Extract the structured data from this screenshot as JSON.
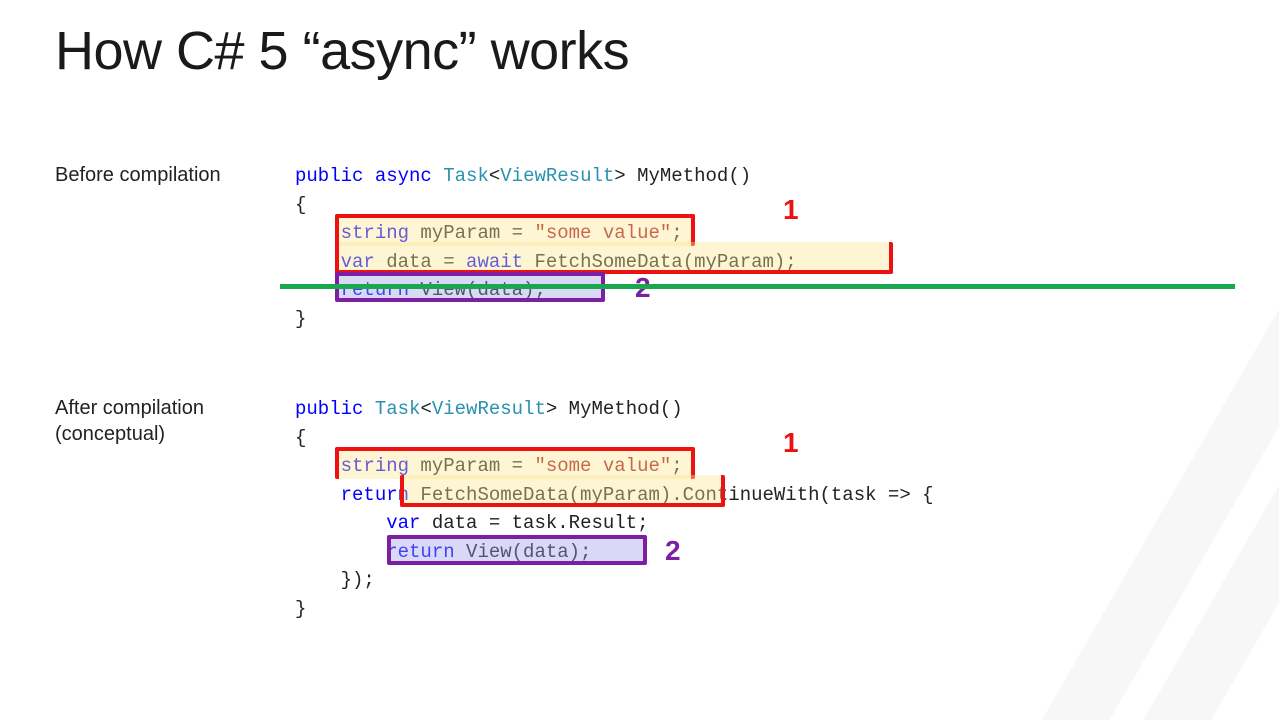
{
  "title": "How C# 5 “async” works",
  "sections": {
    "before": {
      "label": "Before compilation",
      "code": {
        "line1_kw_public": "public",
        "line1_kw_async": "async",
        "line1_type_task": "Task",
        "line1_type_vr": "ViewResult",
        "line1_method": " MyMethod()",
        "line2_brace": "{",
        "line3_kw_string": "string",
        "line3_rest": " myParam = ",
        "line3_str": "\"some value\"",
        "line3_semi": ";",
        "line4_kw_var": "var",
        "line4_data": " data = ",
        "line4_kw_await": "await",
        "line4_call": " FetchSomeData(myParam);",
        "line5_kw_return": "return",
        "line5_call": " View(data);",
        "line6_brace": "}"
      },
      "labels": {
        "one": "1",
        "two": "2"
      }
    },
    "after": {
      "label": "After compilation (conceptual)",
      "code": {
        "line1_kw_public": "public",
        "line1_type_task": "Task",
        "line1_type_vr": "ViewResult",
        "line1_method": " MyMethod()",
        "line2_brace": "{",
        "line3_kw_string": "string",
        "line3_rest": " myParam = ",
        "line3_str": "\"some value\"",
        "line3_semi": ";",
        "line4_kw_return": "return",
        "line4_fetch": " FetchSomeData(myParam)",
        "line4_cw": ".ContinueWith(task => {",
        "line5_kw_var": "var",
        "line5_rest": " data = task.Result;",
        "line6_kw_return": "return",
        "line6_call": " View(data);",
        "line7_close": "    });",
        "line8_brace": "}"
      },
      "labels": {
        "one": "1",
        "two": "2"
      }
    }
  },
  "colors": {
    "keyword": "#0000ff",
    "type": "#2b91af",
    "string": "#a31515",
    "highlight_red_border": "#e11",
    "highlight_red_fill": "rgba(253,230,150,0.55)",
    "highlight_purple_border": "#7c1fa2",
    "highlight_purple_fill": "rgba(160,160,235,0.45)",
    "green_line": "#1aa84f"
  }
}
